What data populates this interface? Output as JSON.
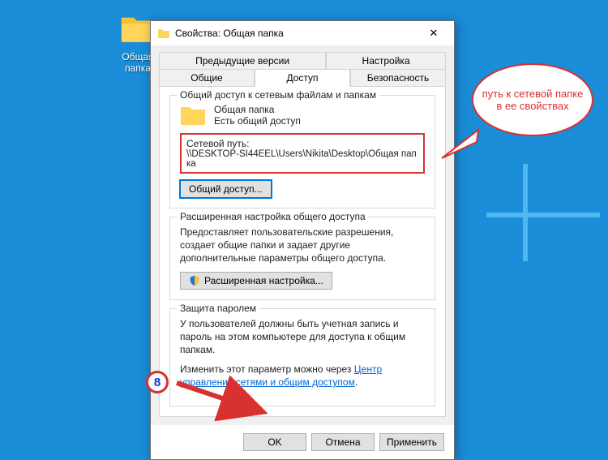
{
  "desktop": {
    "shortcut_label": "Общая папка"
  },
  "dialog": {
    "title": "Свойства: Общая папка",
    "close_glyph": "✕",
    "tabs": {
      "prev_versions": "Предыдущие версии",
      "customize": "Настройка",
      "general": "Общие",
      "sharing": "Доступ",
      "security": "Безопасность"
    },
    "sharing_panel": {
      "group_network_title": "Общий доступ к сетевым файлам и папкам",
      "folder_name": "Общая папка",
      "share_status": "Есть общий доступ",
      "netpath_label": "Сетевой путь:",
      "netpath_value": "\\\\DESKTOP-SI44EEL\\Users\\Nikita\\Desktop\\Общая папка",
      "share_button": "Общий доступ...",
      "group_advanced_title": "Расширенная настройка общего доступа",
      "advanced_desc": "Предоставляет пользовательские разрешения, создает общие папки и задает другие дополнительные параметры общего доступа.",
      "advanced_button": "Расширенная настройка...",
      "group_password_title": "Защита паролем",
      "password_desc": "У пользователей должны быть учетная запись и пароль на этом компьютере для доступа к общим папкам.",
      "password_change_prefix": "Изменить этот параметр можно через ",
      "password_link": "Центр управления сетями и общим доступом",
      "password_suffix": "."
    },
    "buttons": {
      "ok": "OK",
      "cancel": "Отмена",
      "apply": "Применить"
    }
  },
  "annotation": {
    "bubble_text": "путь к сетевой папке в ее свойствах",
    "step_number": "8"
  }
}
